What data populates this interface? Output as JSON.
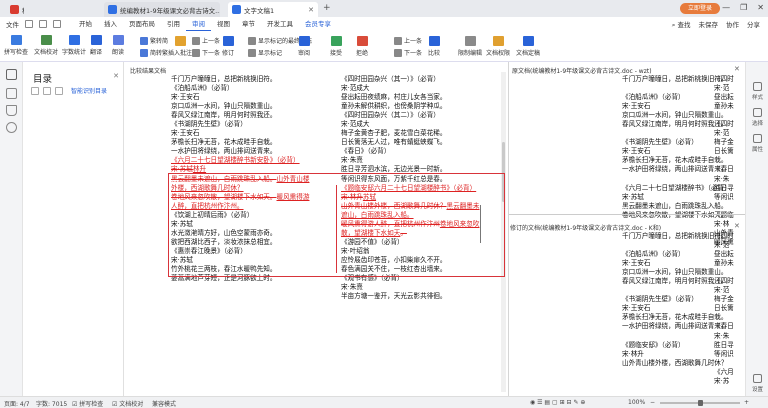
{
  "titlebar": {
    "tabs": [
      {
        "label": "稻壳"
      },
      {
        "label": "统编教材1-9年级课文必背古诗文..."
      },
      {
        "label": "文字文稿1"
      }
    ],
    "login_label": "立即登录"
  },
  "menubar": {
    "file_label": "文件",
    "tabs": [
      "开始",
      "插入",
      "页面布局",
      "引用",
      "审阅",
      "视图",
      "章节",
      "开发工具",
      "会员专享"
    ],
    "active_tab": "审阅",
    "search_label": "查找",
    "right_items": [
      "未保存",
      "协作",
      "分享"
    ]
  },
  "ribbon": {
    "items": [
      "拼写检查",
      "文档校对",
      "字数统计",
      "翻译",
      "朗读",
      "繁转简",
      "简转繁",
      "插入批注",
      "上一条",
      "下一条",
      "修订",
      "显示标记的最终状态",
      "显示标记",
      "审阅",
      "接受",
      "拒绝",
      "上一条",
      "下一条",
      "比较",
      "限制编辑",
      "文档权限",
      "文档定稿"
    ]
  },
  "toc": {
    "title": "目录",
    "smart_toc": "智能识别目录"
  },
  "panes": {
    "compare_title": "比较结果文档",
    "original_title": "原文档(统编教材1-9年级课文必背古诗文.doc - wzt)",
    "revised_title": "修订的文档(统编教材1-9年级课文必背古诗文.doc - K和)"
  },
  "compare_left": [
    "千门万户曈曈日，总把新桃换旧符。",
    "",
    "《泊船瓜洲》（必背）",
    "宋·王安石",
    "京口瓜洲一水间，钟山只隔数重山。",
    "春风又绿江南岸，明月何时照我还。",
    "",
    "《书湖阴先生壁》（必背）",
    "宋·王安石",
    "茅檐长扫净无苔，花木成畦手自栽。",
    "一水护田将绿绕，两山排闼送青来。",
    "",
    "《六月二十七日望湖楼醉书[新安卧]》（必背）",
    "宋·苏轼[林升]",
    "黑云翻墨未遮山，白雨跳珠乱入船。[山外青山楼外楼，西湖歌舞几时休？]",
    "卷地风来忽吹散，望湖楼下水如天。[暖风熏得游人醉，直把杭州作汴州。]",
    "",
    "",
    "",
    "",
    "《饮湖上初晴后雨》（必背）",
    "宋·苏轼",
    "水光潋滟晴方好，山色空蒙雨亦奇。",
    "欲把西湖比西子，淡妆浓抹总相宜。",
    "",
    "《惠崇春江晚景》（必背）",
    "宋·苏轼",
    "竹外桃花三两枝，春江水暖鸭先知。",
    "蒌蒿满地芦芽短，正是河豚欲上时。"
  ],
  "compare_right": [
    "《四时田园杂兴（其一）》（必背）",
    "宋·范成大",
    "昼出耘田夜绩麻，村庄儿女各当家。",
    "童孙未解供耕织，也傍桑阴学种瓜。",
    "",
    "《四时田园杂兴（其二）》（必背）",
    "宋·范成大",
    "梅子金黄杏子肥，麦花雪白菜花稀。",
    "日长篱落无人过，唯有蜻蜓蛱蝶飞。",
    "",
    "《春日》（必背）",
    "宋·朱熹",
    "胜日寻芳泗水滨，无边光景一时新。",
    "等闲识得东风面，万紫千红总是春。",
    "",
    "《题临安邸[六月二十七日望湖楼醉书]》（必背）",
    "",
    "宋·林升[苏轼]",
    "山外青山楼外楼，西湖歌舞几时休？[黑云翻墨未遮山，白雨跳珠乱入船。]",
    "暖风熏得游人醉，直把杭州作汴州[卷地风来忽吹散，望湖楼下水如天]。",
    "",
    "《游园不值》（必背）",
    "宋·叶绍翁",
    "应怜屐齿印苍苔，小扣柴扉久不开。",
    "春色满园关不住，一枝红杏出墙来。",
    "",
    "《观书有感》（必背）",
    "宋·朱熹",
    "半亩方塘一鉴开，天光云影共徘徊。"
  ],
  "orig_left": [
    "千门万户曈曈日，总把新桃换旧符。",
    "",
    "《泊船瓜洲》（必背）",
    "宋·王安石",
    "京口瓜洲一水间，钟山只隔数重山。",
    "春风又绿江南岸，明月何时照我还。",
    "",
    "《书湖阴先生壁》（必背）",
    "宋·王安石",
    "茅檐长扫净无苔，花木成畦手自栽。",
    "一水护田将绿绕，两山排闼送青来。",
    "",
    "《六月二十七日望湖楼醉书》（必背）",
    "宋·苏轼",
    "黑云翻墨未遮山，白雨跳珠乱入船。",
    "卷地风来忽吹散，望湖楼下水如天。"
  ],
  "orig_right": [
    "《四时",
    "宋·范",
    "昼出耘",
    "童孙未",
    "",
    "《四时",
    "宋·范",
    "梅子金",
    "日长篱",
    "",
    "《春日",
    "宋·朱",
    "胜日寻",
    "等闲识",
    "",
    "《题临",
    "宋·林",
    "山外青",
    "暖风熏"
  ],
  "rev_left": [
    "千门万户曈曈日，总把新桃换旧符。",
    "",
    "《泊船瓜洲》（必背）",
    "宋·王安石",
    "京口瓜洲一水间，钟山只隔数重山。",
    "春风又绿江南岸，明月何时照我还。",
    "",
    "《书湖阴先生壁》（必背）",
    "宋·王安石",
    "茅檐长扫净无苔，花木成畦手自栽。",
    "一水护田将绿绕，两山排闼送青来。",
    "",
    "《题临安邸》（必背）",
    "宋·林升",
    "山外青山楼外楼，西湖歌舞几时休？"
  ],
  "rev_right": [
    "《四时",
    "宋·范",
    "昼出耘",
    "童孙未",
    "",
    "《四时",
    "宋·范",
    "梅子金",
    "日长篱",
    "",
    "《春日",
    "宋·朱",
    "胜日寻",
    "等闲识",
    "",
    "《六月",
    "宋·苏"
  ],
  "statusbar": {
    "page": "页面: 4/7",
    "words": "字数: 7015",
    "spell": "拼写检查",
    "proof": "文档校对",
    "compat": "兼容模式",
    "zoom": "100%"
  },
  "right_panel": [
    "样式",
    "选择",
    "属性",
    "设置"
  ],
  "colors": {
    "accent": "#2a63d8",
    "revision": "#d22",
    "box": "#d8343a"
  }
}
